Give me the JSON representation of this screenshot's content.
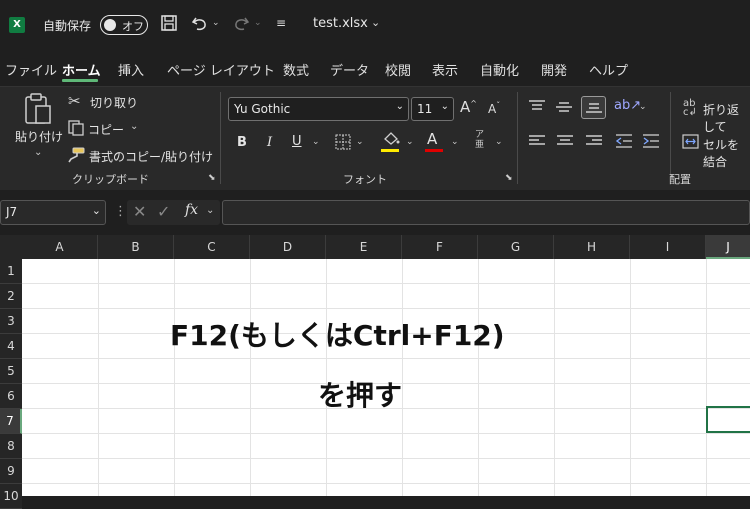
{
  "titlebar": {
    "app_icon_label": "X",
    "autosave_label": "自動保存",
    "autosave_toggle": "オフ",
    "filename": "test.xlsx"
  },
  "tabs": [
    "ファイル",
    "ホーム",
    "挿入",
    "ページ レイアウト",
    "数式",
    "データ",
    "校閲",
    "表示",
    "自動化",
    "開発",
    "ヘルプ"
  ],
  "active_tab": "ホーム",
  "ribbon": {
    "clipboard": {
      "paste": "貼り付け",
      "cut": "切り取り",
      "copy": "コピー",
      "format_painter": "書式のコピー/貼り付け",
      "group_label": "クリップボード"
    },
    "font": {
      "font_name": "Yu Gothic",
      "font_size": "11",
      "bold": "B",
      "italic": "I",
      "underline": "U",
      "font_color_label": "A",
      "phonetic": "ア",
      "group_label": "フォント",
      "highlight_color": "#ffeb00",
      "font_color": "#e00000"
    },
    "alignment": {
      "wrap_text": "折り返して",
      "merge": "セルを結合",
      "group_label": "配置"
    }
  },
  "formula_bar": {
    "name_box": "J7",
    "fx": "fx",
    "value": ""
  },
  "sheet": {
    "columns": [
      "A",
      "B",
      "C",
      "D",
      "E",
      "F",
      "G",
      "H",
      "I",
      "J"
    ],
    "rows": [
      "1",
      "2",
      "3",
      "4",
      "5",
      "6",
      "7",
      "8",
      "9",
      "10"
    ],
    "selected_column": "J",
    "selected_row": "7",
    "line1": "F12(もしくはCtrl+F12)",
    "line2": "を押す"
  }
}
